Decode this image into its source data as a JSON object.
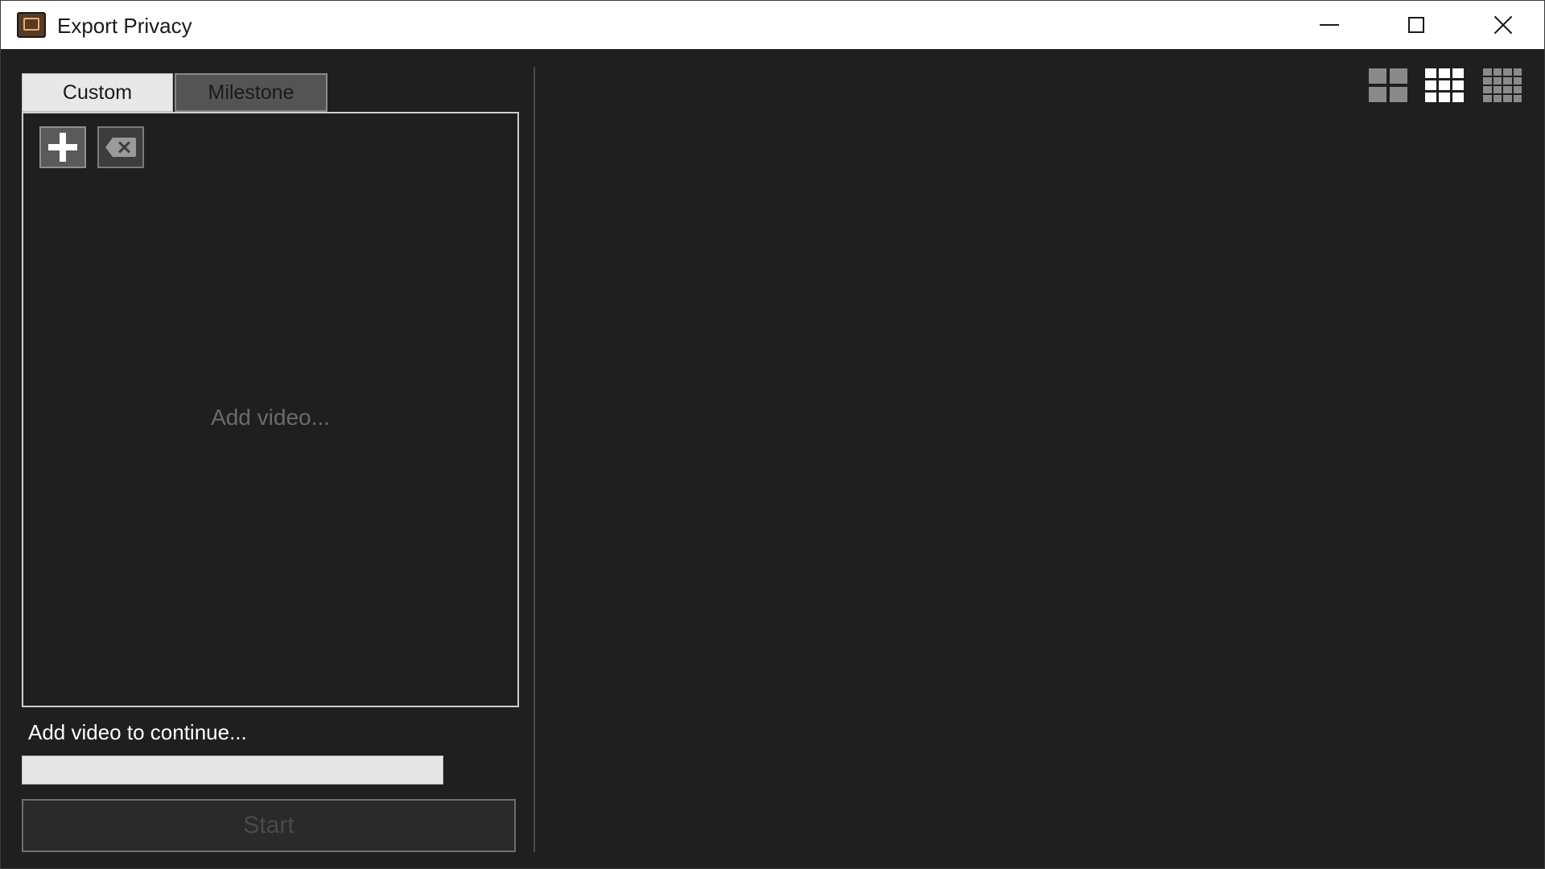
{
  "window": {
    "title": "Export Privacy",
    "app_icon": "app-icon",
    "controls": [
      "minimize-icon",
      "maximize-icon",
      "close-icon"
    ]
  },
  "tabs": [
    {
      "label": "Custom",
      "selected": true
    },
    {
      "label": "Milestone",
      "selected": false
    }
  ],
  "toolbar": {
    "add_icon": "plus-icon",
    "remove_icon": "backspace-icon"
  },
  "video_list": {
    "placeholder": "Add video..."
  },
  "status": {
    "text": "Add video to continue...",
    "progress": 0
  },
  "start_button": {
    "label": "Start",
    "enabled": false
  },
  "layout_buttons": [
    {
      "icon": "grid-2x2-icon",
      "active": false
    },
    {
      "icon": "grid-3x3-icon",
      "active": true
    },
    {
      "icon": "grid-4x4-icon",
      "active": false
    }
  ],
  "colors": {
    "background": "#1f1f1f",
    "titlebar": "#ffffff",
    "tab_selected": "#e8e8e8",
    "tab_unselected": "#545454",
    "placeholder_text": "#6a6a6a",
    "progress_accent": "#3a8ee6"
  }
}
